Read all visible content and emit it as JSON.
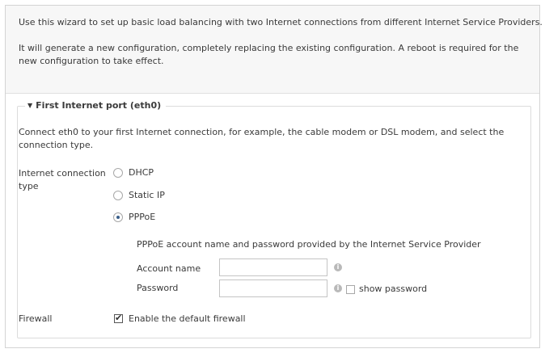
{
  "intro": {
    "line1": "Use this wizard to set up basic load balancing with two Internet connections from different Internet Service Providers.",
    "line2": "It will generate a new configuration, completely replacing the existing configuration. A reboot is required for the new configuration to take effect."
  },
  "section": {
    "title": "First Internet port (eth0)",
    "description": "Connect eth0 to your first Internet connection, for example, the cable modem or DSL modem, and select the connection type."
  },
  "connection_type": {
    "label": "Internet connection type",
    "options": [
      {
        "label": "DHCP",
        "selected": false
      },
      {
        "label": "Static IP",
        "selected": false
      },
      {
        "label": "PPPoE",
        "selected": true
      }
    ]
  },
  "pppoe": {
    "note": "PPPoE account name and password provided by the Internet Service Provider",
    "account_label": "Account name",
    "account_value": "",
    "password_label": "Password",
    "password_value": "",
    "info_glyph": "i",
    "show_password_label": "show password",
    "show_password_checked": false
  },
  "firewall": {
    "label": "Firewall",
    "checkbox_label": "Enable the default firewall",
    "checked": true
  }
}
